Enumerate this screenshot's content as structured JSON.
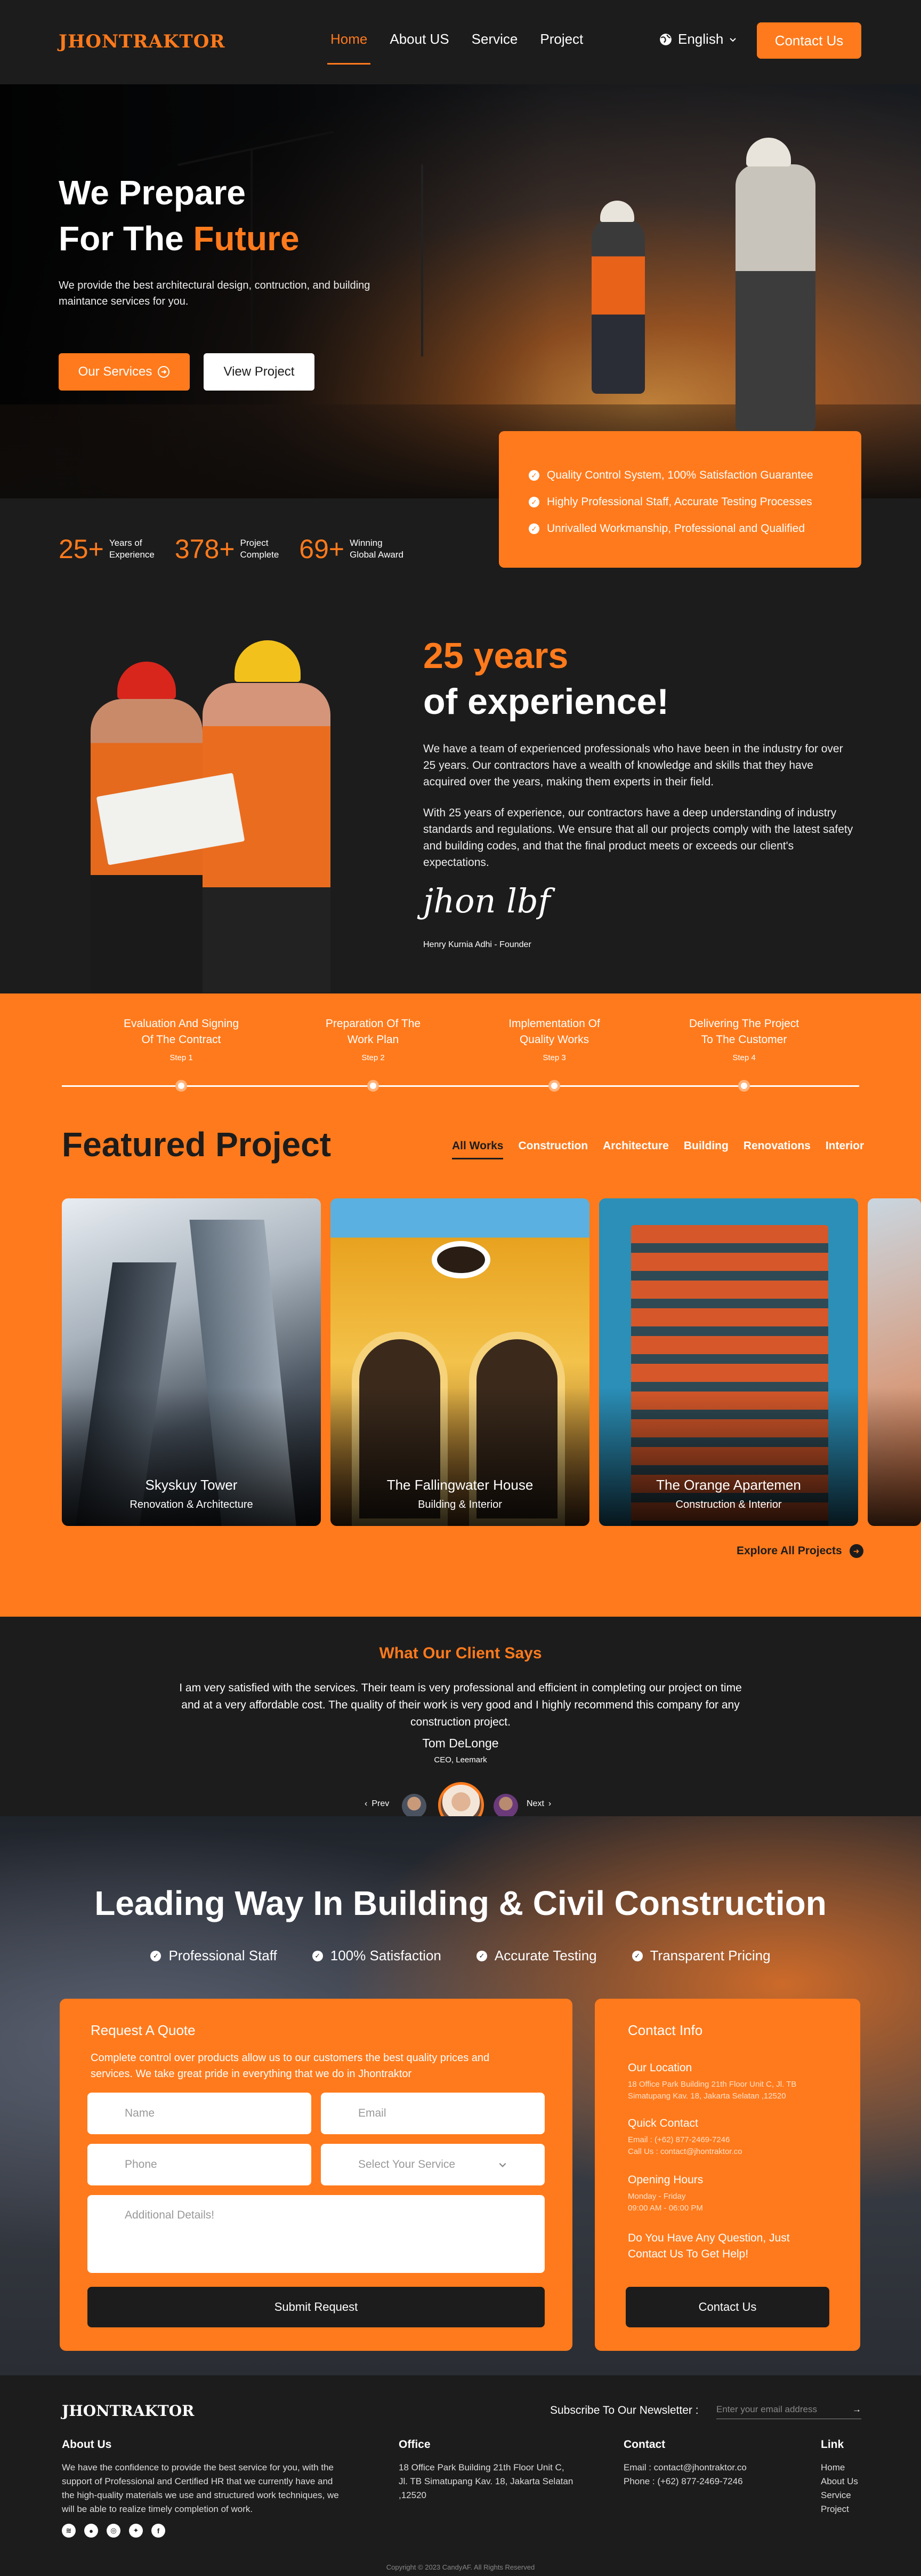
{
  "header": {
    "logo": "JHONTRAKTOR",
    "nav": [
      "Home",
      "About US",
      "Service",
      "Project"
    ],
    "language": "English",
    "contact_button": "Contact Us"
  },
  "hero": {
    "title_line1": "We Prepare",
    "title_line2_a": "For The",
    "title_line2_b": "Future",
    "description": "We provide the best architectural design, contruction, and building maintance services for you.",
    "primary_button": "Our Services",
    "secondary_button": "View Project"
  },
  "quality": [
    "Quality Control System, 100% Satisfaction Guarantee",
    "Highly Professional Staff, Accurate Testing Processes",
    "Unrivalled Workmanship, Professional and Qualified"
  ],
  "stats": [
    {
      "num": "25+",
      "label": "Years of\nExperience"
    },
    {
      "num": "378+",
      "label": "Project\nComplete"
    },
    {
      "num": "69+",
      "label": "Winning\nGlobal Award"
    }
  ],
  "about": {
    "title_a": "25 years",
    "title_b": "of experience!",
    "p1": "We have a team of experienced professionals who have been in the industry for over 25 years. Our contractors have a wealth of knowledge and skills that they have acquired over the years, making them experts in their field.",
    "p2": "With 25 years of experience, our contractors have a deep understanding of industry standards and regulations. We ensure that all our projects comply with the latest safety and building codes, and that the final product meets or exceeds our client's expectations.",
    "signature": "jhon lbf",
    "founder": "Henry Kurnia Adhi - Founder"
  },
  "steps": [
    {
      "title": "Evaluation And Signing\nOf The Contract",
      "step": "Step 1"
    },
    {
      "title": "Preparation Of The\nWork Plan",
      "step": "Step 2"
    },
    {
      "title": "Implementation Of\nQuality Works",
      "step": "Step 3"
    },
    {
      "title": "Delivering The Project\nTo The Customer",
      "step": "Step 4"
    }
  ],
  "featured": {
    "title": "Featured Project",
    "filters": [
      "All Works",
      "Construction",
      "Architecture",
      "Building",
      "Renovations",
      "Interior"
    ],
    "cards": [
      {
        "name": "Skyskuy Tower",
        "category": "Renovation & Architecture"
      },
      {
        "name": "The Fallingwater House",
        "category": "Building & Interior"
      },
      {
        "name": "The Orange Apartemen",
        "category": "Construction & Interior"
      }
    ],
    "explore": "Explore All Projects"
  },
  "testimonial": {
    "title": "What Our Client Says",
    "quote": "I am very satisfied with the services. Their team is very professional and efficient in completing our project on time and at a very affordable cost. The quality of their work is very good and I highly recommend this company for any construction project.",
    "name": "Tom DeLonge",
    "role": "CEO, Leemark",
    "prev": "Prev",
    "next": "Next"
  },
  "leading": {
    "title": "Leading Way In Building & Civil Construction",
    "features": [
      "Professional Staff",
      "100% Satisfaction",
      "Accurate Testing",
      "Transparent Pricing"
    ]
  },
  "quote_form": {
    "title": "Request A Quote",
    "description": "Complete control over products allow us to our customers the best quality prices and services. We take great pride in everything that we do in Jhontraktor",
    "name_placeholder": "Name",
    "email_placeholder": "Email",
    "phone_placeholder": "Phone",
    "service_placeholder": "Select Your Service",
    "details_placeholder": "Additional Details!",
    "submit": "Submit Request"
  },
  "contact_info": {
    "title": "Contact Info",
    "location_h": "Our Location",
    "location_t": "18 Office Park Building 21th Floor Unit C, Jl. TB Simatupang Kav. 18, Jakarta Selatan ,12520",
    "quick_h": "Quick Contact",
    "email": "Email : (+62) 877-2469-7246",
    "call": "Call Us : contact@jhontraktor.co",
    "hours_h": "Opening Hours",
    "days": "Monday - Friday",
    "time": "09:00 AM - 06:00 PM",
    "ask": "Do You Have Any Question, Just Contact Us To Get Help!",
    "button": "Contact Us"
  },
  "footer": {
    "logo": "JHONTRAKTOR",
    "newsletter": "Subscribe To Our Newsletter :",
    "newsletter_placeholder": "Enter your email address",
    "about_h": "About Us",
    "about_t": "We have the confidence to provide the best service for you, with the support of Professional and Certified HR that we currently have and the high-quality materials we use and structured work techniques, we will be able to realize timely completion of work.",
    "office_h": "Office",
    "office_t": "18 Office Park Building 21th Floor Unit C, Jl. TB Simatupang Kav. 18, Jakarta Selatan ,12520",
    "contact_h": "Contact",
    "contact_email": "Email : contact@jhontraktor.co",
    "contact_phone": "Phone : (+62) 877-2469-7246",
    "link_h": "Link",
    "links": [
      "Home",
      "About Us",
      "Service",
      "Project"
    ],
    "copyright": "Copyright © 2023 CandyAF. All Rights Reserved"
  },
  "colors": {
    "accent": "#ff7a1c",
    "dark": "#1c1c1c"
  }
}
